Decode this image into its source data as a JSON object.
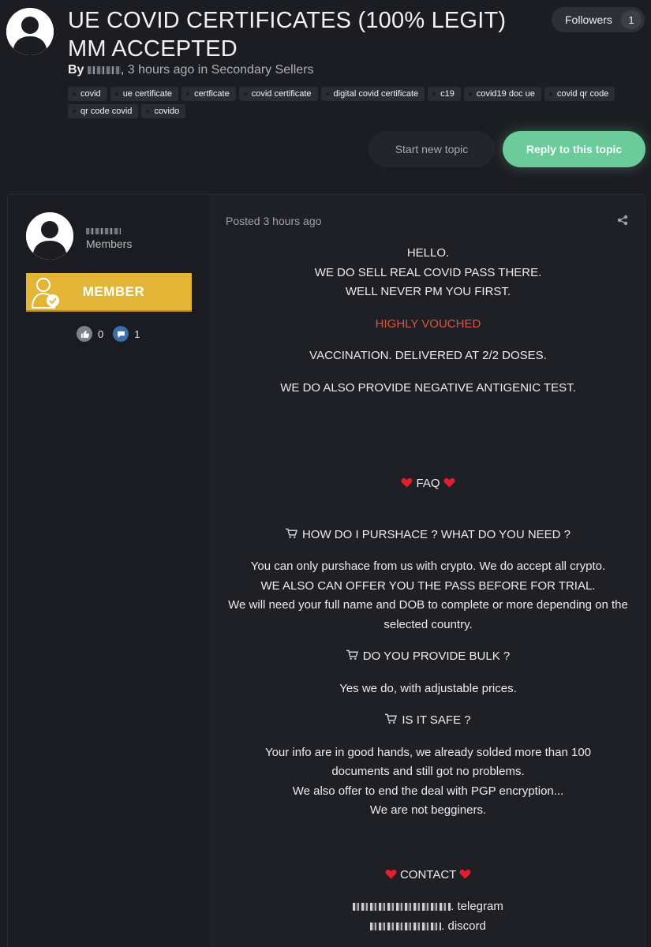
{
  "topic": {
    "title": "UE COVID CERTIFICATES (100% LEGIT) MM ACCEPTED",
    "by_label": "By",
    "time": "3 hours ago",
    "in_label": "in",
    "forum": "Secondary Sellers",
    "followers_label": "Followers",
    "followers_count": "1",
    "tags": [
      "covid",
      "ue certificate",
      "certficate",
      "covid certificate",
      "digital covid certificate",
      "c19",
      "covid19 doc ue",
      "covid qr code",
      "qr code covid",
      "covido"
    ]
  },
  "actions": {
    "start_new_topic": "Start new topic",
    "reply_to_topic": "Reply to this topic"
  },
  "post": {
    "author_group": "Members",
    "badge": "MEMBER",
    "likes": "0",
    "comments": "1",
    "posted": "Posted 3 hours ago",
    "lines": {
      "hello": "HELLO.",
      "sell": "WE DO SELL REAL COVID PASS THERE.",
      "never_pm": "WELL NEVER PM YOU FIRST.",
      "vouched": "HIGHLY VOUCHED",
      "vaccination": "VACCINATION. DELIVERED AT 2/2 DOSES.",
      "antigenic": "WE DO ALSO PROVIDE NEGATIVE ANTIGENIC TEST.",
      "faq": "FAQ",
      "q1": "HOW DO I PURSHACE ? WHAT DO YOU NEED ?",
      "a1_1": "You can only purshace from us with crypto. We do accept all crypto.",
      "a1_2": "WE ALSO CAN OFFER YOU THE PASS BEFORE FOR TRIAL.",
      "a1_3": "We will need your full name and DOB to complete or more depending on the selected country.",
      "q2": "DO YOU PROVIDE BULK ?",
      "a2": "Yes we do, with adjustable prices.",
      "q3": "IS IT SAFE ?",
      "a3_1": "Your info are in good hands, we already solded more than 100 documents and still got no problems.",
      "a3_2": "We also offer to end the deal with PGP encryption...",
      "a3_3": "We are not begginers.",
      "contact": "CONTACT",
      "telegram": ". telegram",
      "discord": ". discord"
    }
  },
  "colors": {
    "background": "#1c1d22",
    "reply_button": "#6ccb9b",
    "badge": "#e3b536",
    "highlight_red": "#d9553f"
  },
  "icons": [
    "user-avatar-icon",
    "member-badge-icon",
    "like-icon",
    "comment-icon",
    "share-icon",
    "heart-icon",
    "cart-icon"
  ]
}
